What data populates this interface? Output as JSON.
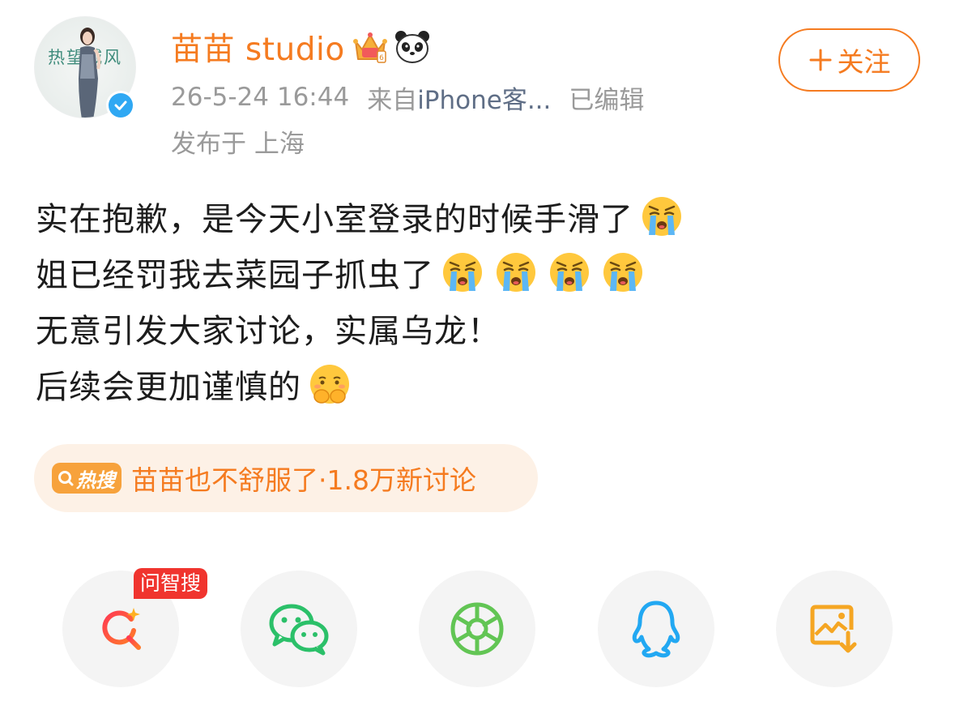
{
  "colors": {
    "accent": "#f57b20",
    "meta_gray": "#9a9a9a",
    "source_link": "#5f6e86",
    "hot_pill_bg": "#fdf1e6",
    "verify_blue": "#2fa8f3",
    "ai_tag_red": "#f0342e",
    "share_bg": "#f4f4f4"
  },
  "post": {
    "avatar_text": "热望城风",
    "username": "苗苗 studio",
    "badges": [
      "crown-icon",
      "panda-icon"
    ],
    "verified": true,
    "timestamp": "26-5-24 16:44",
    "source_prefix": "来自",
    "source": "iPhone客...",
    "edited": "已编辑",
    "location": "发布于 上海",
    "follow_label": "关注",
    "lines": [
      {
        "text": "实在抱歉，是今天小室登录的时候手滑了",
        "emojis": [
          "crying-emoji"
        ]
      },
      {
        "text": "姐已经罚我去菜园子抓虫了",
        "emojis": [
          "crying-emoji",
          "crying-emoji",
          "crying-emoji",
          "crying-emoji"
        ]
      },
      {
        "text": "无意引发大家讨论，实属乌龙！",
        "emojis": []
      },
      {
        "text": "后续会更加谨慎的",
        "emojis": [
          "pleading-hands-emoji"
        ]
      }
    ]
  },
  "hot_search": {
    "badge": "热搜",
    "text": "苗苗也不舒服了·1.8万新讨论"
  },
  "share": {
    "ai_tag": "问智搜",
    "items": [
      "ai-search-icon",
      "wechat-icon",
      "moments-icon",
      "qq-icon",
      "save-image-icon"
    ]
  }
}
